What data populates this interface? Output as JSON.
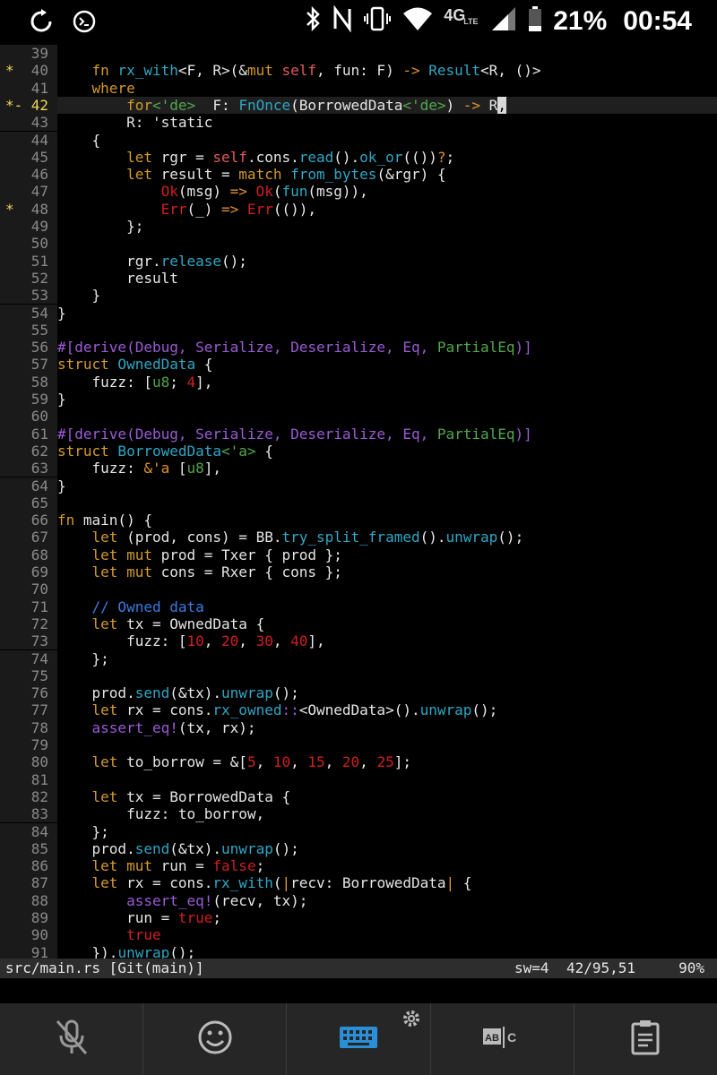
{
  "status": {
    "left_icons": [
      "sync-icon",
      "terminal-icon"
    ],
    "right_icons": [
      "bluetooth-icon",
      "nfc-icon",
      "vibrate-icon",
      "wifi-icon",
      "signal-icon",
      "battery-icon"
    ],
    "network": "4G",
    "network_sub": "LTE",
    "battery": "21%",
    "time": "00:54"
  },
  "editor": {
    "lines": [
      {
        "n": "39",
        "mark": ""
      },
      {
        "n": "40",
        "mark": "*"
      },
      {
        "n": "41",
        "mark": ""
      },
      {
        "n": "42",
        "mark": "*-"
      },
      {
        "n": "43",
        "mark": ""
      },
      {
        "n": "44",
        "mark": ""
      },
      {
        "n": "45",
        "mark": ""
      },
      {
        "n": "46",
        "mark": ""
      },
      {
        "n": "47",
        "mark": ""
      },
      {
        "n": "48",
        "mark": "*"
      },
      {
        "n": "49",
        "mark": ""
      },
      {
        "n": "50",
        "mark": ""
      },
      {
        "n": "51",
        "mark": ""
      },
      {
        "n": "52",
        "mark": ""
      },
      {
        "n": "53",
        "mark": ""
      },
      {
        "n": "54",
        "mark": ""
      },
      {
        "n": "55",
        "mark": ""
      },
      {
        "n": "56",
        "mark": ""
      },
      {
        "n": "57",
        "mark": ""
      },
      {
        "n": "58",
        "mark": ""
      },
      {
        "n": "59",
        "mark": ""
      },
      {
        "n": "60",
        "mark": ""
      },
      {
        "n": "61",
        "mark": ""
      },
      {
        "n": "62",
        "mark": ""
      },
      {
        "n": "63",
        "mark": ""
      },
      {
        "n": "64",
        "mark": ""
      },
      {
        "n": "65",
        "mark": ""
      },
      {
        "n": "66",
        "mark": ""
      },
      {
        "n": "67",
        "mark": ""
      },
      {
        "n": "68",
        "mark": ""
      },
      {
        "n": "69",
        "mark": ""
      },
      {
        "n": "70",
        "mark": ""
      },
      {
        "n": "71",
        "mark": ""
      },
      {
        "n": "72",
        "mark": ""
      },
      {
        "n": "73",
        "mark": ""
      },
      {
        "n": "74",
        "mark": ""
      },
      {
        "n": "75",
        "mark": ""
      },
      {
        "n": "76",
        "mark": ""
      },
      {
        "n": "77",
        "mark": ""
      },
      {
        "n": "78",
        "mark": ""
      },
      {
        "n": "79",
        "mark": ""
      },
      {
        "n": "80",
        "mark": ""
      },
      {
        "n": "81",
        "mark": ""
      },
      {
        "n": "82",
        "mark": ""
      },
      {
        "n": "83",
        "mark": ""
      },
      {
        "n": "84",
        "mark": ""
      },
      {
        "n": "85",
        "mark": ""
      },
      {
        "n": "86",
        "mark": ""
      },
      {
        "n": "87",
        "mark": ""
      },
      {
        "n": "88",
        "mark": ""
      },
      {
        "n": "89",
        "mark": ""
      },
      {
        "n": "90",
        "mark": ""
      },
      {
        "n": "91",
        "mark": ""
      }
    ]
  },
  "vim_status": {
    "file": "src/main.rs",
    "branch": "[Git(main)]",
    "sw": "sw=4",
    "position": "42/95,51",
    "percent": "90%"
  },
  "toolbar": {
    "icons": [
      "mic-off-icon",
      "emoji-icon",
      "keyboard-icon",
      "spellcheck-icon",
      "clipboard-icon"
    ],
    "settings_icon": "gear-icon"
  },
  "colors": {
    "keyword": "#d49a2b",
    "type": "#2fa8c6",
    "number": "#d11f1f",
    "attribute": "#9b5bd6",
    "comment": "#3c7be0"
  }
}
